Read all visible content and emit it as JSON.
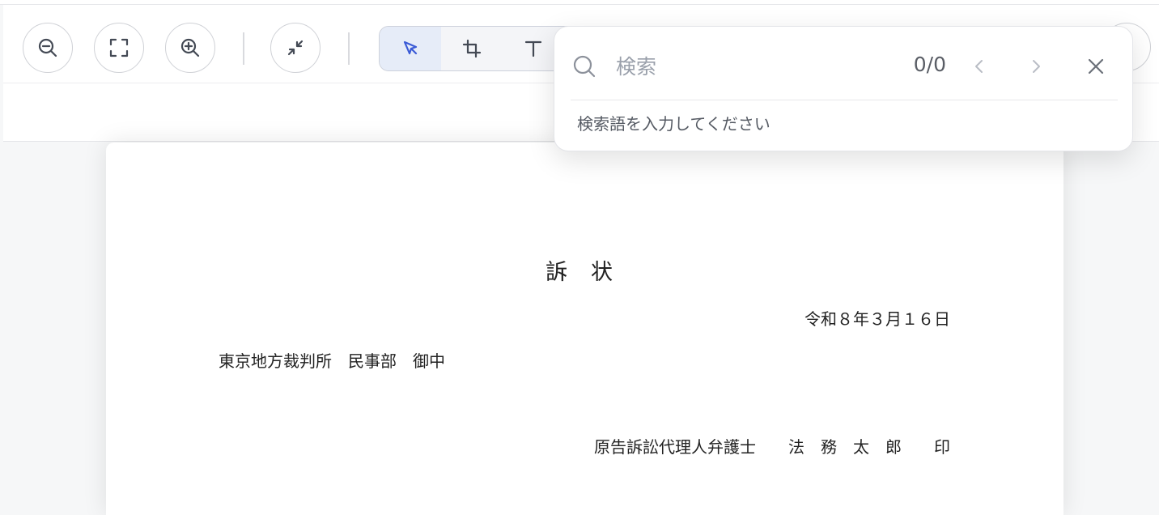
{
  "toolbar": {
    "zoom_out_icon": "zoom-out-icon",
    "fit_icon": "fit-screen-icon",
    "zoom_in_icon": "zoom-in-icon",
    "collapse_icon": "collapse-icon",
    "tools": [
      {
        "name": "select",
        "icon": "cursor-icon",
        "active": true
      },
      {
        "name": "crop",
        "icon": "crop-icon",
        "active": false
      },
      {
        "name": "text",
        "icon": "text-icon",
        "active": false
      }
    ]
  },
  "search": {
    "placeholder": "検索",
    "value": "",
    "counter": "0/0",
    "hint": "検索語を入力してください"
  },
  "document": {
    "title": "訴　状",
    "date": "令和８年３月１６日",
    "court": "東京地方裁判所　民事部　御中",
    "signature": "原告訴訟代理人弁護士　　法　務　太　郎　　印"
  },
  "colors": {
    "accent": "#3b5bd6",
    "active_tool_bg": "#e6ecf8",
    "icon": "#444a55",
    "muted": "#9aa0ab"
  }
}
